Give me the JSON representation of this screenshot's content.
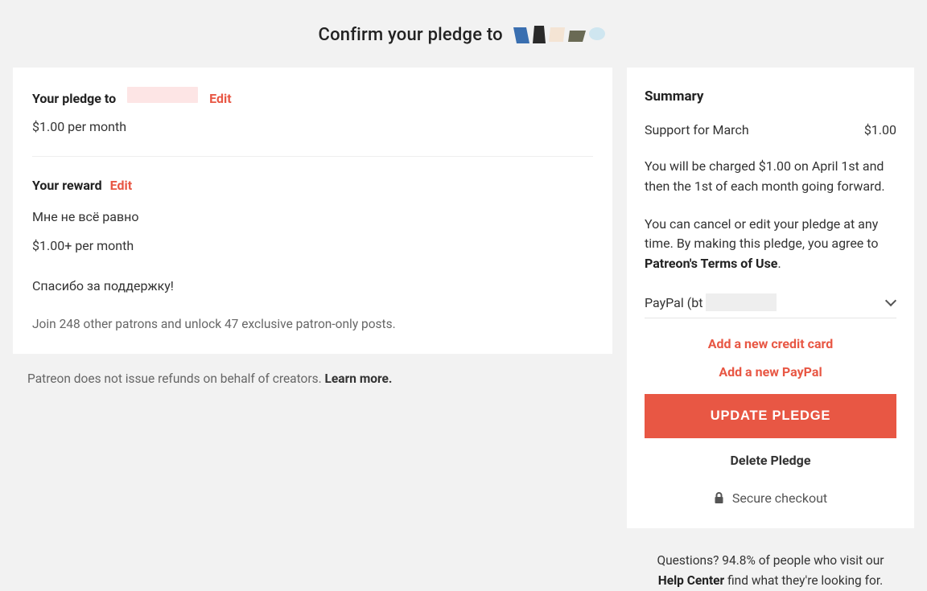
{
  "header": {
    "title_prefix": "Confirm your pledge to"
  },
  "pledge": {
    "heading_prefix": "Your pledge to",
    "edit_label": "Edit",
    "amount_line": "$1.00 per month"
  },
  "reward": {
    "heading": "Your reward",
    "edit_label": "Edit",
    "title": "Мне не всё равно",
    "price": "$1.00+ per month",
    "thanks": "Спасибо за поддержку!",
    "join_line": "Join 248 other patrons and unlock 47 exclusive patron-only posts."
  },
  "refund_note": {
    "text": "Patreon does not issue refunds on behalf of creators. ",
    "learn_more": "Learn more."
  },
  "summary": {
    "heading": "Summary",
    "support_label": "Support for March",
    "amount": "$1.00",
    "charge_text": "You will be charged $1.00 on April 1st and then the 1st of each month going forward.",
    "cancel_text_prefix": "You can cancel or edit your pledge at any time. By making this pledge, you agree to ",
    "terms_label": "Patreon's Terms of Use",
    "period": ".",
    "payment_method_label": "PayPal (bt",
    "add_card": "Add a new credit card",
    "add_paypal": "Add a new PayPal",
    "update_btn": "UPDATE PLEDGE",
    "delete_btn": "Delete Pledge",
    "secure_label": "Secure checkout"
  },
  "help": {
    "line1": "Questions? 94.8% of people who visit our",
    "help_center_label": "Help Center",
    "line2_suffix": " find what they're looking for."
  }
}
